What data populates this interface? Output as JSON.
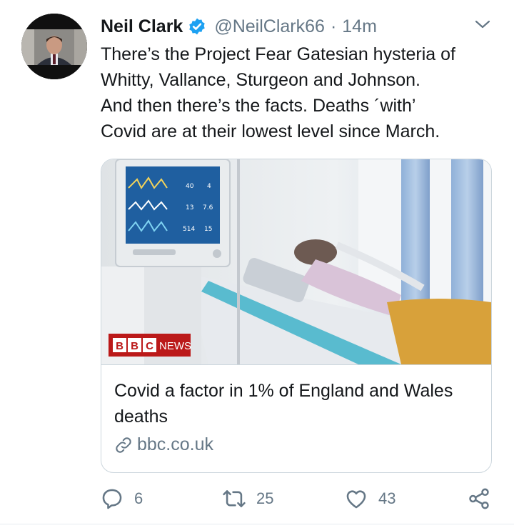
{
  "tweet": {
    "author_name": "Neil Clark",
    "handle": "@NeilClark66",
    "separator": "·",
    "time": "14m",
    "text": "There’s the Project Fear Gatesian hysteria of\nWhitty, Vallance, Sturgeon and Johnson.\nAnd then there’s the facts. Deaths ´with’\nCovid are at their lowest level since March.",
    "verified_color": "#1da1f2"
  },
  "card": {
    "badge_letters": [
      "B",
      "B",
      "C"
    ],
    "badge_word": "NEWS",
    "title": "Covid a factor in 1% of England and Wales deaths",
    "domain": "bbc.co.uk",
    "monitor_readouts": [
      "40",
      "4",
      "13",
      "7.6",
      "514",
      "15"
    ]
  },
  "actions": {
    "replies": "6",
    "retweets": "25",
    "likes": "43"
  },
  "colors": {
    "text": "#14171a",
    "secondary": "#657786",
    "border": "#ccd6dd",
    "bbc_red": "#bb1919"
  }
}
